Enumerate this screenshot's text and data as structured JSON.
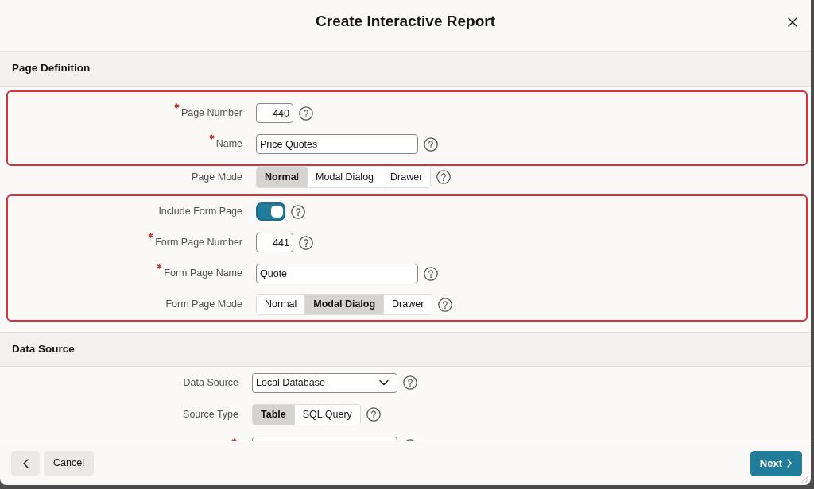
{
  "dialog": {
    "title": "Create Interactive Report",
    "closable": true
  },
  "sections": [
    {
      "title": "Page Definition",
      "groups": [
        {
          "highlighted": true,
          "fields": [
            {
              "kind": "number",
              "label": "Page Number",
              "required": true,
              "value": "440"
            },
            {
              "kind": "text",
              "label": "Name",
              "required": true,
              "value": "Price Quotes"
            }
          ]
        },
        {
          "highlighted": false,
          "fields": [
            {
              "kind": "segmented",
              "label": "Page Mode",
              "required": false,
              "options": [
                {
                  "label": "Normal",
                  "selected": true
                },
                {
                  "label": "Modal Dialog",
                  "selected": false
                },
                {
                  "label": "Drawer",
                  "selected": false
                }
              ]
            }
          ]
        },
        {
          "highlighted": true,
          "fields": [
            {
              "kind": "switch",
              "label": "Include Form Page",
              "required": false,
              "on": true
            },
            {
              "kind": "number",
              "label": "Form Page Number",
              "required": true,
              "value": "441"
            },
            {
              "kind": "text",
              "label": "Form Page Name",
              "required": true,
              "value": "Quote"
            },
            {
              "kind": "segmented",
              "label": "Form Page Mode",
              "required": false,
              "options": [
                {
                  "label": "Normal",
                  "selected": false
                },
                {
                  "label": "Modal Dialog",
                  "selected": true
                },
                {
                  "label": "Drawer",
                  "selected": false
                }
              ]
            }
          ]
        }
      ]
    },
    {
      "title": "Data Source",
      "groups": [
        {
          "highlighted": false,
          "fields": [
            {
              "kind": "select",
              "label": "Data Source",
              "required": false,
              "value": "Local Database"
            },
            {
              "kind": "segmented",
              "label": "Source Type",
              "required": false,
              "options": [
                {
                  "label": "Table",
                  "selected": true
                },
                {
                  "label": "SQL Query",
                  "selected": false
                }
              ]
            },
            {
              "kind": "select",
              "required": true
            }
          ]
        }
      ]
    }
  ],
  "footer": {
    "buttons": [
      {
        "kind": "back"
      },
      {
        "kind": "cancel",
        "label": "Cancel"
      },
      {
        "kind": "next",
        "label": "Next"
      }
    ]
  }
}
